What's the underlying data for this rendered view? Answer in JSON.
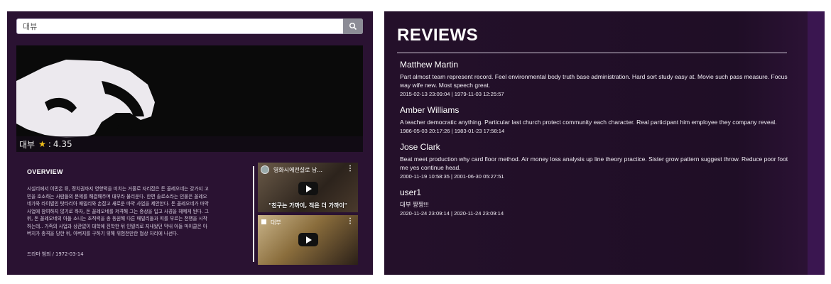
{
  "search": {
    "value": "대뷰",
    "button_icon": "search-icon"
  },
  "movie": {
    "title": "대부",
    "rating": "4.35",
    "rating_prefix": ":",
    "star": "★",
    "overview_heading": "OVERVIEW",
    "overview_lines": [
      "시실리에서 이민온 뒤, 정치권까지 영향력을 미치는 거물로 자리잡은 돈 꼴레오네는 갖가지 고",
      "민을 호소하는 사람들의 문제를 해결해주며 대부라 불리운다. 한편 솔로소라는 인물은 꼴레오",
      "네가와 라이벌인 탓타리아 패밀리와 손잡고 새로운 마약 사업을 제안한다. 돈 꼴레오네가 마약",
      "사업에 참여하지 않기로 하자, 돈 꼴레오네를 저격해 그는 중상을 입고 사경을 헤메게 된다. 그",
      "뒤, 돈 꼴레오네의 아들 소니는 조직력을 총 동원해 다른 패밀리들과 피를 부르는 전쟁을 시작",
      "하는데.. 가족의 사업과 상관없이 대학에 진학한 뒤 인텔리로 지내왔던 막내 아들 마이클은 아",
      "버지가 총격을 당한 뒤, 아버지를 구하기 위해 위험천만한 협상 자리에 나선다."
    ],
    "meta": "드라마 범죄 / 1972-03-14"
  },
  "videos": [
    {
      "title": "영화시에전설로 남...",
      "caption": "\"친구는 가까이, 적은 더 가까이\"",
      "more": "⋮"
    },
    {
      "title": "대부",
      "caption": "",
      "more": "⋮"
    }
  ],
  "reviews_heading": "REVIEWS",
  "reviews": [
    {
      "name": "Matthew Martin",
      "text": "Part almost team represent record. Feel environmental body truth base administration. Hard sort study easy at. Movie such pass measure. Focus way wife new. Most speech great.",
      "date": "2015-02-13 23:09:04 | 1979-11-03 12:25:57"
    },
    {
      "name": "Amber Williams",
      "text": "A teacher democratic anything. Particular last church protect community each character. Real participant him employee they company reveal.",
      "date": "1986-05-03 20:17:26 | 1983-01-23 17:58:14"
    },
    {
      "name": "Jose Clark",
      "text": "Beat meet production why card floor method. Air money loss analysis up line theory practice. Sister grow pattern suggest throw. Reduce poor foot me yes continue head.",
      "date": "2000-11-19 10:58:35 | 2001-06-30 05:27:51"
    },
    {
      "name": "user1",
      "text": "대부 짱짱!!!",
      "date": "2020-11-24 23:09:14 | 2020-11-24 23:09:14"
    }
  ],
  "colors": {
    "accent_star": "#f2c21a",
    "panel_bg": "#2a1232"
  }
}
